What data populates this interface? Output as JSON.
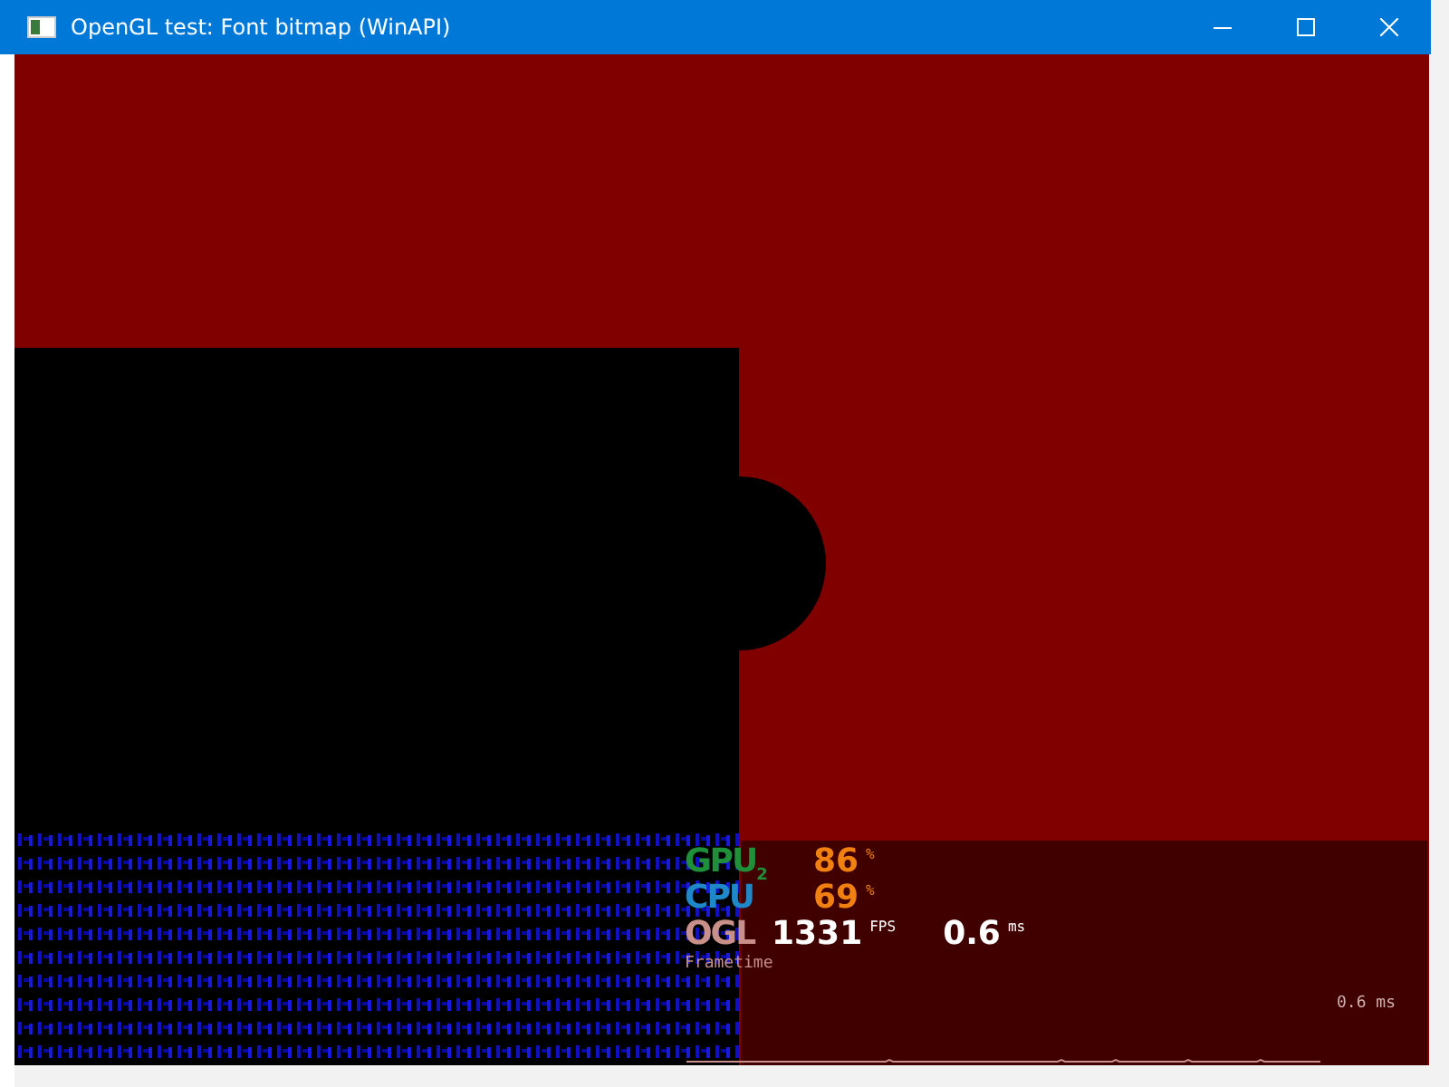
{
  "window": {
    "title": "OpenGL test: Font bitmap (WinAPI)"
  },
  "overlay": {
    "rows": [
      {
        "kind": "percent",
        "label": "GPU",
        "sub": "2",
        "value": "86",
        "unit": "%",
        "color": "#1f8f3a"
      },
      {
        "kind": "percent",
        "label": "CPU",
        "sub": "",
        "value": "69",
        "unit": "%",
        "color": "#1e88c8"
      },
      {
        "kind": "fps",
        "label": "OGL",
        "value": "1331",
        "unit": "FPS",
        "time": "0.6",
        "time_unit": "ms",
        "color": "#c89088"
      }
    ],
    "graph_label": "Frametime",
    "graph_reading": "0.6 ms"
  }
}
